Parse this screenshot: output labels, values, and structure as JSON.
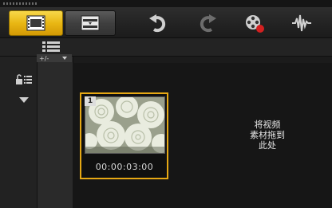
{
  "toolbar": {
    "buttons": [
      {
        "id": "storyboard",
        "icon": "film-strip-icon",
        "active": true
      },
      {
        "id": "timeline",
        "icon": "timeline-icon",
        "active": false
      },
      {
        "id": "undo",
        "icon": "undo-icon"
      },
      {
        "id": "redo",
        "icon": "redo-icon"
      },
      {
        "id": "record",
        "icon": "record-capture-icon"
      },
      {
        "id": "audio",
        "icon": "audio-waveform-icon"
      }
    ]
  },
  "storyboard": {
    "clip": {
      "number": "1",
      "duration": "00:00:03:00",
      "thumbnail": "white-roses"
    },
    "drop_hint": {
      "line1": "将视频",
      "line2": "素材拖到",
      "line3": "此处"
    }
  },
  "colors": {
    "accent": "#e6a814",
    "background": "#161616"
  }
}
